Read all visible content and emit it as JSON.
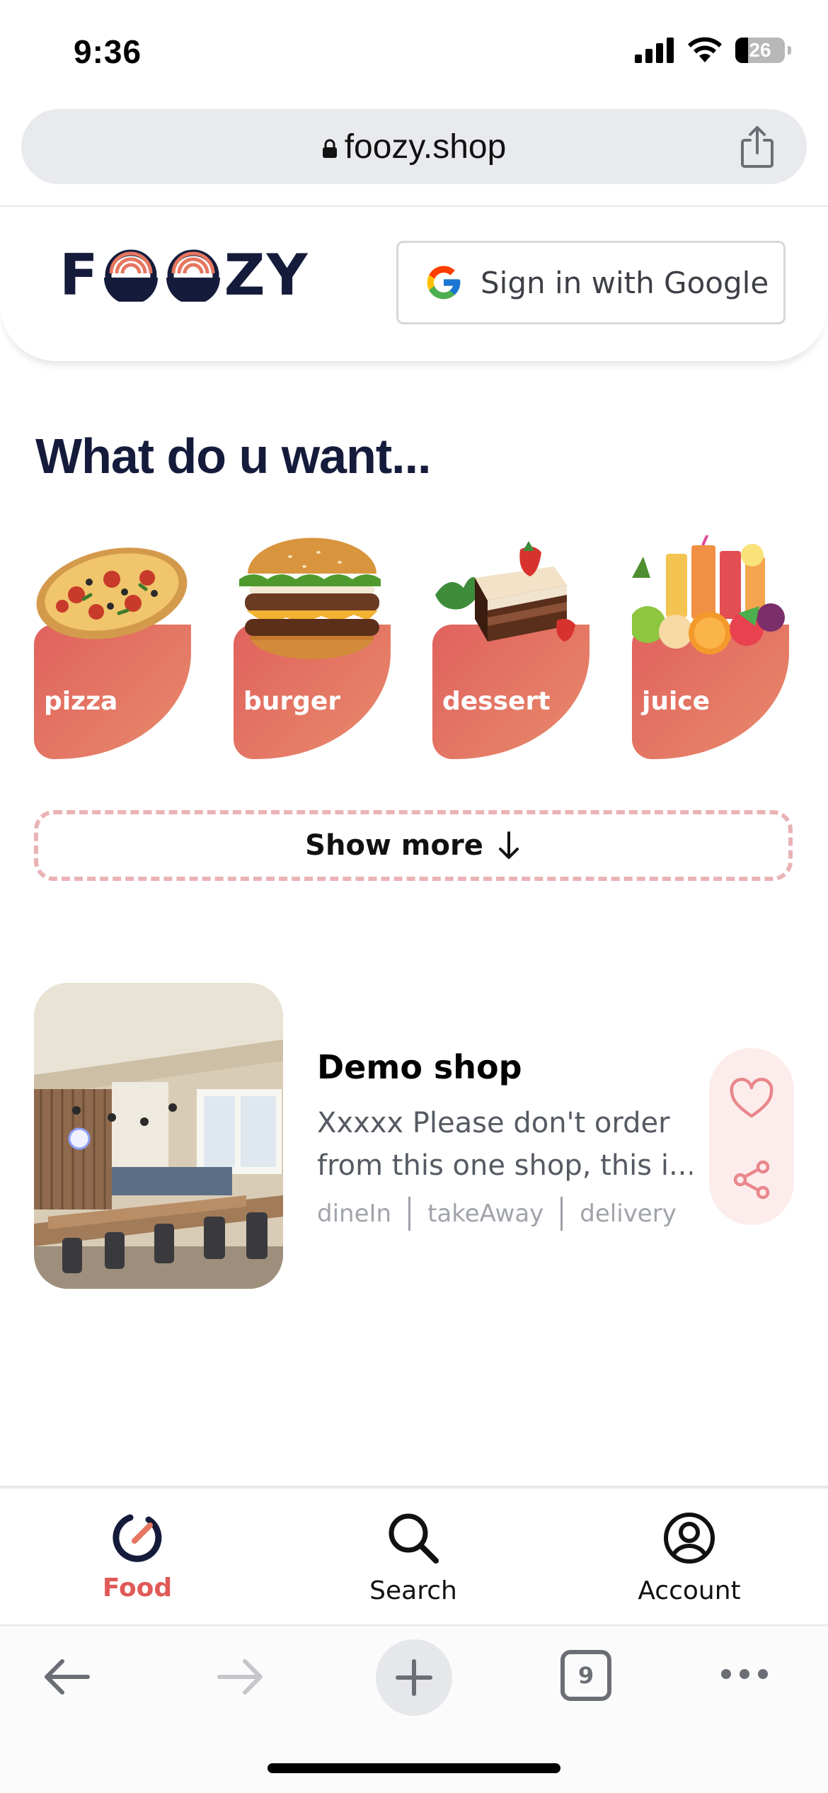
{
  "status_bar": {
    "time": "9:36",
    "battery_percent": "26",
    "battery_level": 0.26
  },
  "browser": {
    "url": "foozy.shop",
    "tab_count": "9"
  },
  "header": {
    "logo_left": "F",
    "logo_right": "ZY",
    "logo_alt": "FOOZY",
    "sign_in_label": "Sign in with Google"
  },
  "main": {
    "title": "What do u want...",
    "categories": [
      {
        "label": "pizza",
        "icon": "pizza-image"
      },
      {
        "label": "burger",
        "icon": "burger-image"
      },
      {
        "label": "dessert",
        "icon": "dessert-image"
      },
      {
        "label": "juice",
        "icon": "juice-image"
      }
    ],
    "show_more_label": "Show more"
  },
  "shop": {
    "name": "Demo shop",
    "description_line1": "Xxxxx Please don't order",
    "description_line2": "from this one shop, this i...",
    "tags": [
      "dineIn",
      "takeAway",
      "delivery"
    ]
  },
  "bottom_nav": {
    "items": [
      {
        "label": "Food",
        "icon": "food-logo-icon",
        "active": true
      },
      {
        "label": "Search",
        "icon": "search-icon",
        "active": false
      },
      {
        "label": "Account",
        "icon": "account-icon",
        "active": false
      }
    ]
  },
  "colors": {
    "accent": "#e05a58",
    "brand_navy": "#151b3b",
    "category_gradient_start": "#e0625d",
    "category_gradient_end": "#e88a6b",
    "dashed_border": "#eab3b6",
    "action_pill_bg": "#fdecec"
  }
}
